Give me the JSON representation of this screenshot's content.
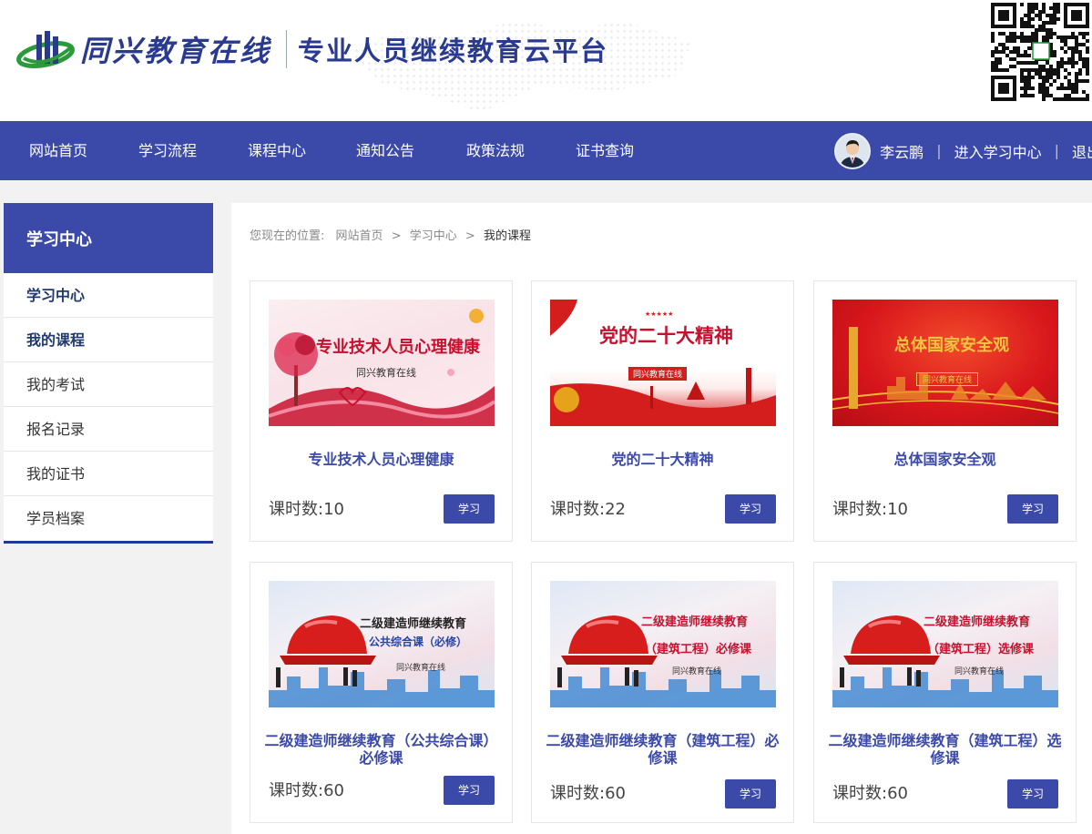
{
  "header": {
    "logo_name": "同兴教育在线",
    "slogan": "专业人员继续教育云平台"
  },
  "nav": {
    "items": [
      "网站首页",
      "学习流程",
      "课程中心",
      "通知公告",
      "政策法规",
      "证书查询"
    ],
    "user_name": "李云鹏",
    "enter_center": "进入学习中心",
    "logout": "退出",
    "separator": "|"
  },
  "sidebar": {
    "title": "学习中心",
    "items": [
      "学习中心",
      "我的课程",
      "我的考试",
      "报名记录",
      "我的证书",
      "学员档案"
    ]
  },
  "breadcrumb": {
    "prefix": "您现在的位置:",
    "items": [
      "网站首页",
      "学习中心",
      "我的课程"
    ],
    "separator": ">"
  },
  "courses": [
    {
      "title": "专业技术人员心理健康",
      "hours_label": "课时数:",
      "hours": "10",
      "button": "学习",
      "image_lines": [
        "专业技术人员心理健康",
        "同兴教育在线"
      ]
    },
    {
      "title": "党的二十大精神",
      "hours_label": "课时数:",
      "hours": "22",
      "button": "学习",
      "image_lines": [
        "党的二十大精神",
        "同兴教育在线",
        "★★★★★"
      ]
    },
    {
      "title": "总体国家安全观",
      "hours_label": "课时数:",
      "hours": "10",
      "button": "学习",
      "image_lines": [
        "总体国家安全观",
        "同兴教育在线"
      ]
    },
    {
      "title": "二级建造师继续教育（公共综合课）必修课",
      "hours_label": "课时数:",
      "hours": "60",
      "button": "学习",
      "image_lines": [
        "二级建造师继续教育",
        "公共综合课（必修）",
        "同兴教育在线"
      ]
    },
    {
      "title": "二级建造师继续教育（建筑工程）必修课",
      "hours_label": "课时数:",
      "hours": "60",
      "button": "学习",
      "image_lines": [
        "二级建造师继续教育",
        "（建筑工程）必修课",
        "同兴教育在线"
      ]
    },
    {
      "title": "二级建造师继续教育（建筑工程）选修课",
      "hours_label": "课时数:",
      "hours": "60",
      "button": "学习",
      "image_lines": [
        "二级建造师继续教育",
        "（建筑工程）选修课",
        "同兴教育在线"
      ]
    }
  ],
  "colors": {
    "primary": "#3b49a8",
    "sidebar_accent": "#1f3a93",
    "logo_green": "#2a9a3a"
  }
}
